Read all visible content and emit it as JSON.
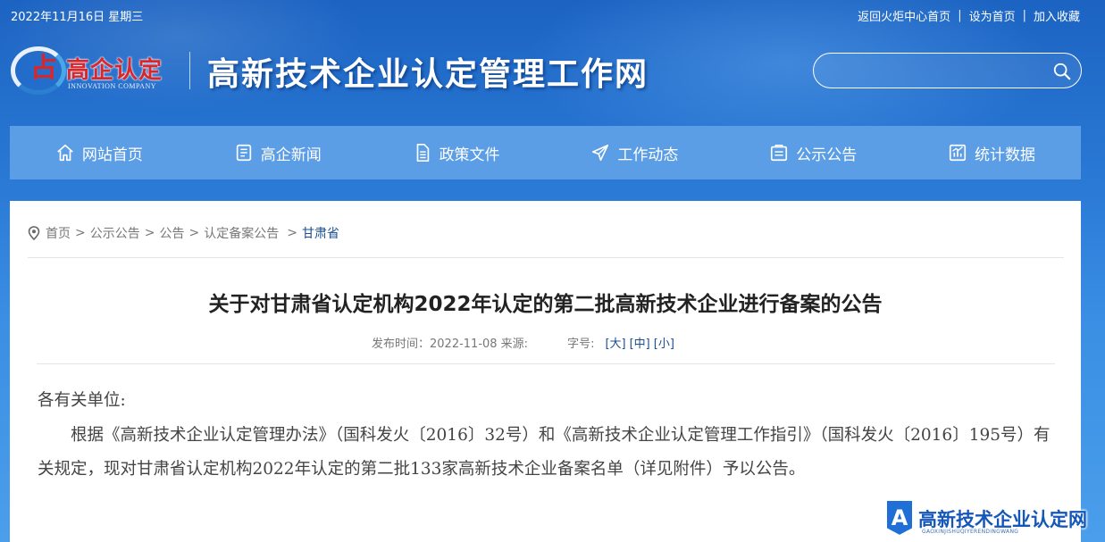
{
  "topbar": {
    "date": "2022年11月16日 星期三",
    "links": [
      "返回火炬中心首页",
      "设为首页",
      "加入收藏"
    ],
    "separator": "|"
  },
  "logo": {
    "mark": "占",
    "cn": "高企认定",
    "en": "INNOVATION COMPANY"
  },
  "site_title": "高新技术企业认定管理工作网",
  "search": {
    "placeholder": "",
    "icon": "search-icon"
  },
  "nav": [
    {
      "label": "网站首页",
      "icon": "home-icon"
    },
    {
      "label": "高企新闻",
      "icon": "news-icon"
    },
    {
      "label": "政策文件",
      "icon": "document-icon"
    },
    {
      "label": "工作动态",
      "icon": "paper-plane-icon"
    },
    {
      "label": "公示公告",
      "icon": "notice-icon"
    },
    {
      "label": "统计数据",
      "icon": "chart-icon"
    }
  ],
  "breadcrumb": {
    "items": [
      "首页",
      "公示公告",
      "公告",
      "认定备案公告"
    ],
    "current": "甘肃省",
    "arrow": ">"
  },
  "article": {
    "title": "关于对甘肃省认定机构2022年认定的第二批高新技术企业进行备案的公告",
    "meta_publish": "发布时间：2022-11-08 来源:",
    "meta_fontsize_label": "字号:",
    "font_sizes": [
      "[大]",
      "[中]",
      "[小]"
    ],
    "salutation": "各有关单位:",
    "paragraph": "根据《高新技术企业认定管理办法》（国科发火〔2016〕32号）和《高新技术企业认定管理工作指引》（国科发火〔2016〕195号）有关规定，现对甘肃省认定机构2022年认定的第二批133家高新技术企业备案名单（详见附件）予以公告。"
  },
  "watermark": {
    "title": "高新技术企业认定网",
    "sub": "GAOXINJISHUQIYERENDINGWANG",
    "badge_letter": "A"
  },
  "colors": {
    "nav_bg": "#5b9ee6",
    "accent_red": "#d9262c",
    "link_blue": "#1a4f94"
  }
}
